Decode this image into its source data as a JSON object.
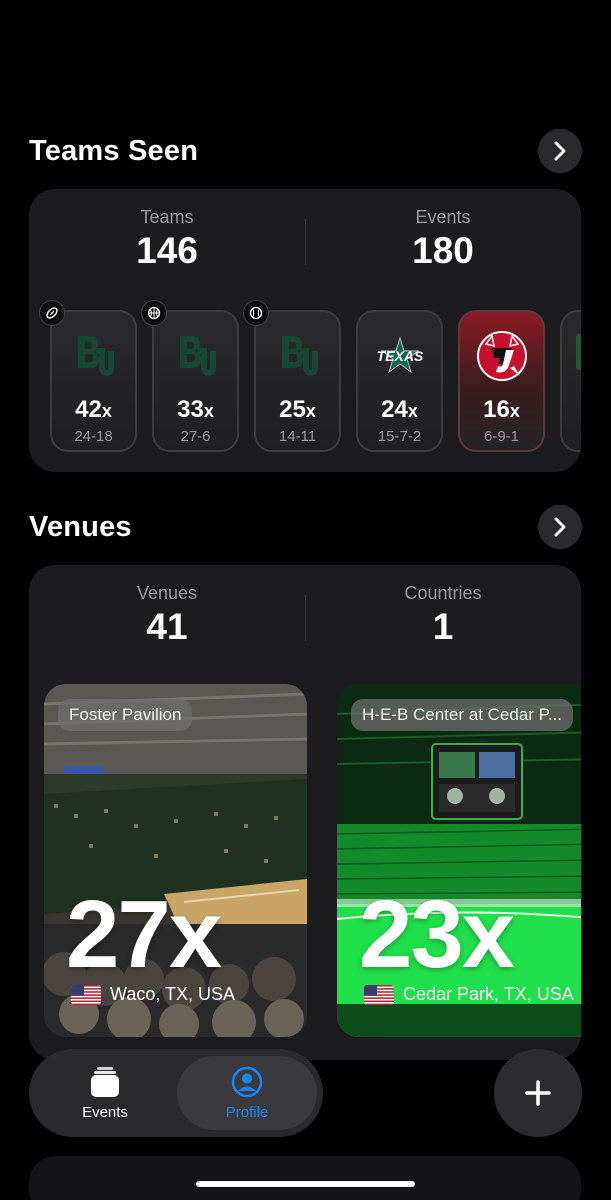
{
  "teams_section": {
    "title": "Teams Seen",
    "stats": [
      {
        "label": "Teams",
        "value": "146"
      },
      {
        "label": "Events",
        "value": "180"
      }
    ],
    "tiles": [
      {
        "count": "42",
        "suffix": "x",
        "record": "24-18",
        "sport_icon": "football-icon",
        "logo": "baylor-logo"
      },
      {
        "count": "33",
        "suffix": "x",
        "record": "27-6",
        "sport_icon": "basketball-icon",
        "logo": "baylor-logo"
      },
      {
        "count": "25",
        "suffix": "x",
        "record": "14-11",
        "sport_icon": "baseball-icon",
        "logo": "baylor-logo"
      },
      {
        "count": "24",
        "suffix": "x",
        "record": "15-7-2",
        "logo": "texas-stars-logo",
        "logo_text": "TEXAS"
      },
      {
        "count": "16",
        "suffix": "x",
        "record": "6-9-1",
        "logo": "new-jersey-devils-logo"
      }
    ]
  },
  "venues_section": {
    "title": "Venues",
    "stats": [
      {
        "label": "Venues",
        "value": "41"
      },
      {
        "label": "Countries",
        "value": "1"
      }
    ],
    "cards": [
      {
        "name": "Foster Pavilion",
        "count": "27x",
        "location": "Waco, TX, USA"
      },
      {
        "name": "H-E-B Center at Cedar P...",
        "count": "23x",
        "location": "Cedar Park, TX, USA"
      }
    ]
  },
  "tabbar": {
    "tabs": [
      {
        "label": "Events",
        "icon": "stack-icon"
      },
      {
        "label": "Profile",
        "icon": "person-circle-icon",
        "active": true
      }
    ],
    "add_icon": "plus-icon"
  },
  "colors": {
    "accent": "#1a84ff",
    "background": "#000000",
    "card": "#1c1c1e",
    "baylor_green": "#154734",
    "devils_red": "#c8102e"
  }
}
